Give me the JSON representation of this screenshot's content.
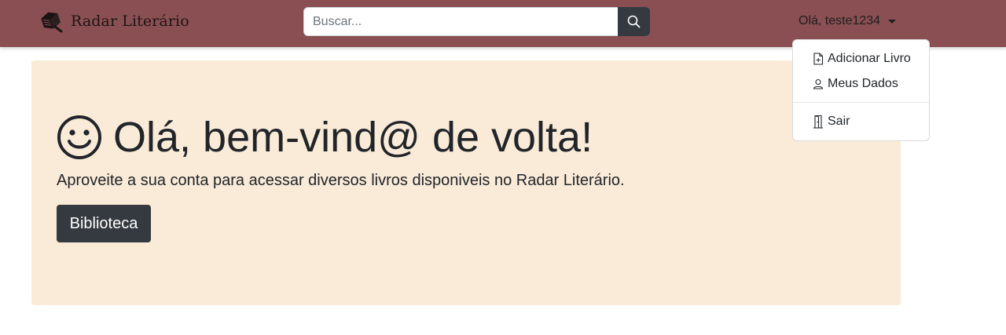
{
  "navbar": {
    "brand_text": "Radar Literário",
    "brand_icon": "book-logo-icon",
    "background_color": "#8a4f52"
  },
  "search": {
    "placeholder": "Buscar...",
    "value": "",
    "button_icon": "search-icon"
  },
  "user_menu": {
    "label": "Olá, teste1234",
    "items": [
      {
        "label": "Adicionar Livro",
        "icon": "file-plus-icon"
      },
      {
        "label": "Meus Dados",
        "icon": "person-icon"
      },
      {
        "label": "Sair",
        "icon": "door-icon"
      }
    ]
  },
  "hero": {
    "icon": "smiley-icon",
    "title": "Olá, bem-vind@ de volta!",
    "text": "Aproveite a sua conta para acessar diversos livros disponiveis no Radar Literário.",
    "button_label": "Biblioteca",
    "background_color": "#faead8"
  }
}
